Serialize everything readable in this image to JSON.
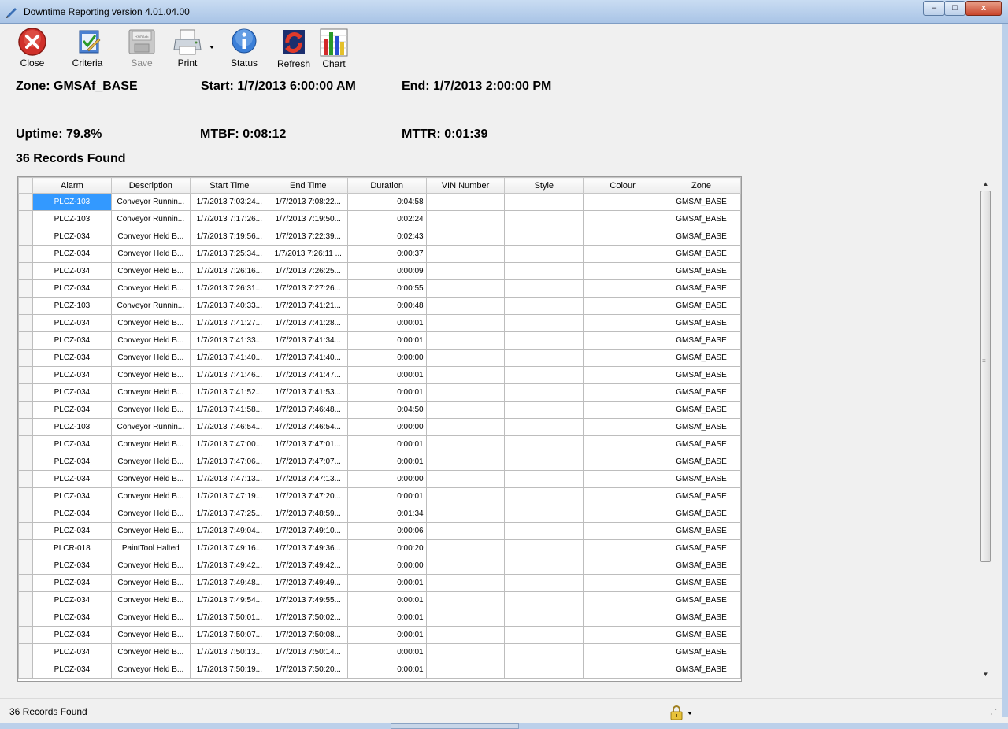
{
  "window": {
    "title": "Downtime Reporting  version  4.01.04.00",
    "min_glyph": "‒",
    "max_glyph": "□",
    "close_glyph": "x"
  },
  "toolbar": {
    "close_label": "Close",
    "criteria_label": "Criteria",
    "save_label": "Save",
    "save_icon_text": "RANGE",
    "print_label": "Print",
    "status_label": "Status",
    "refresh_label": "Refresh",
    "chart_label": "Chart"
  },
  "summary": {
    "zone": "Zone: GMSAf_BASE",
    "start": "Start: 1/7/2013 6:00:00 AM",
    "end": "End: 1/7/2013 2:00:00 PM",
    "uptime": "Uptime: 79.8%",
    "mtbf": "MTBF: 0:08:12",
    "mttr": "MTTR: 0:01:39",
    "records": "36 Records Found"
  },
  "grid": {
    "columns": [
      "Alarm",
      "Description",
      "Start Time",
      "End Time",
      "Duration",
      "VIN Number",
      "Style",
      "Colour",
      "Zone"
    ],
    "selected_row": 0,
    "rows": [
      [
        "PLCZ-103",
        "Conveyor Runnin...",
        "1/7/2013 7:03:24...",
        "1/7/2013 7:08:22...",
        "0:04:58",
        "",
        "",
        "",
        "GMSAf_BASE"
      ],
      [
        "PLCZ-103",
        "Conveyor Runnin...",
        "1/7/2013 7:17:26...",
        "1/7/2013 7:19:50...",
        "0:02:24",
        "",
        "",
        "",
        "GMSAf_BASE"
      ],
      [
        "PLCZ-034",
        "Conveyor Held B...",
        "1/7/2013 7:19:56...",
        "1/7/2013 7:22:39...",
        "0:02:43",
        "",
        "",
        "",
        "GMSAf_BASE"
      ],
      [
        "PLCZ-034",
        "Conveyor Held B...",
        "1/7/2013 7:25:34...",
        "1/7/2013 7:26:11 ...",
        "0:00:37",
        "",
        "",
        "",
        "GMSAf_BASE"
      ],
      [
        "PLCZ-034",
        "Conveyor Held B...",
        "1/7/2013 7:26:16...",
        "1/7/2013 7:26:25...",
        "0:00:09",
        "",
        "",
        "",
        "GMSAf_BASE"
      ],
      [
        "PLCZ-034",
        "Conveyor Held B...",
        "1/7/2013 7:26:31...",
        "1/7/2013 7:27:26...",
        "0:00:55",
        "",
        "",
        "",
        "GMSAf_BASE"
      ],
      [
        "PLCZ-103",
        "Conveyor Runnin...",
        "1/7/2013 7:40:33...",
        "1/7/2013 7:41:21...",
        "0:00:48",
        "",
        "",
        "",
        "GMSAf_BASE"
      ],
      [
        "PLCZ-034",
        "Conveyor Held B...",
        "1/7/2013 7:41:27...",
        "1/7/2013 7:41:28...",
        "0:00:01",
        "",
        "",
        "",
        "GMSAf_BASE"
      ],
      [
        "PLCZ-034",
        "Conveyor Held B...",
        "1/7/2013 7:41:33...",
        "1/7/2013 7:41:34...",
        "0:00:01",
        "",
        "",
        "",
        "GMSAf_BASE"
      ],
      [
        "PLCZ-034",
        "Conveyor Held B...",
        "1/7/2013 7:41:40...",
        "1/7/2013 7:41:40...",
        "0:00:00",
        "",
        "",
        "",
        "GMSAf_BASE"
      ],
      [
        "PLCZ-034",
        "Conveyor Held B...",
        "1/7/2013 7:41:46...",
        "1/7/2013 7:41:47...",
        "0:00:01",
        "",
        "",
        "",
        "GMSAf_BASE"
      ],
      [
        "PLCZ-034",
        "Conveyor Held B...",
        "1/7/2013 7:41:52...",
        "1/7/2013 7:41:53...",
        "0:00:01",
        "",
        "",
        "",
        "GMSAf_BASE"
      ],
      [
        "PLCZ-034",
        "Conveyor Held B...",
        "1/7/2013 7:41:58...",
        "1/7/2013 7:46:48...",
        "0:04:50",
        "",
        "",
        "",
        "GMSAf_BASE"
      ],
      [
        "PLCZ-103",
        "Conveyor Runnin...",
        "1/7/2013 7:46:54...",
        "1/7/2013 7:46:54...",
        "0:00:00",
        "",
        "",
        "",
        "GMSAf_BASE"
      ],
      [
        "PLCZ-034",
        "Conveyor Held B...",
        "1/7/2013 7:47:00...",
        "1/7/2013 7:47:01...",
        "0:00:01",
        "",
        "",
        "",
        "GMSAf_BASE"
      ],
      [
        "PLCZ-034",
        "Conveyor Held B...",
        "1/7/2013 7:47:06...",
        "1/7/2013 7:47:07...",
        "0:00:01",
        "",
        "",
        "",
        "GMSAf_BASE"
      ],
      [
        "PLCZ-034",
        "Conveyor Held B...",
        "1/7/2013 7:47:13...",
        "1/7/2013 7:47:13...",
        "0:00:00",
        "",
        "",
        "",
        "GMSAf_BASE"
      ],
      [
        "PLCZ-034",
        "Conveyor Held B...",
        "1/7/2013 7:47:19...",
        "1/7/2013 7:47:20...",
        "0:00:01",
        "",
        "",
        "",
        "GMSAf_BASE"
      ],
      [
        "PLCZ-034",
        "Conveyor Held B...",
        "1/7/2013 7:47:25...",
        "1/7/2013 7:48:59...",
        "0:01:34",
        "",
        "",
        "",
        "GMSAf_BASE"
      ],
      [
        "PLCZ-034",
        "Conveyor Held B...",
        "1/7/2013 7:49:04...",
        "1/7/2013 7:49:10...",
        "0:00:06",
        "",
        "",
        "",
        "GMSAf_BASE"
      ],
      [
        "PLCR-018",
        "PaintTool Halted",
        "1/7/2013 7:49:16...",
        "1/7/2013 7:49:36...",
        "0:00:20",
        "",
        "",
        "",
        "GMSAf_BASE"
      ],
      [
        "PLCZ-034",
        "Conveyor Held B...",
        "1/7/2013 7:49:42...",
        "1/7/2013 7:49:42...",
        "0:00:00",
        "",
        "",
        "",
        "GMSAf_BASE"
      ],
      [
        "PLCZ-034",
        "Conveyor Held B...",
        "1/7/2013 7:49:48...",
        "1/7/2013 7:49:49...",
        "0:00:01",
        "",
        "",
        "",
        "GMSAf_BASE"
      ],
      [
        "PLCZ-034",
        "Conveyor Held B...",
        "1/7/2013 7:49:54...",
        "1/7/2013 7:49:55...",
        "0:00:01",
        "",
        "",
        "",
        "GMSAf_BASE"
      ],
      [
        "PLCZ-034",
        "Conveyor Held B...",
        "1/7/2013 7:50:01...",
        "1/7/2013 7:50:02...",
        "0:00:01",
        "",
        "",
        "",
        "GMSAf_BASE"
      ],
      [
        "PLCZ-034",
        "Conveyor Held B...",
        "1/7/2013 7:50:07...",
        "1/7/2013 7:50:08...",
        "0:00:01",
        "",
        "",
        "",
        "GMSAf_BASE"
      ],
      [
        "PLCZ-034",
        "Conveyor Held B...",
        "1/7/2013 7:50:13...",
        "1/7/2013 7:50:14...",
        "0:00:01",
        "",
        "",
        "",
        "GMSAf_BASE"
      ],
      [
        "PLCZ-034",
        "Conveyor Held B...",
        "1/7/2013 7:50:19...",
        "1/7/2013 7:50:20...",
        "0:00:01",
        "",
        "",
        "",
        "GMSAf_BASE"
      ]
    ]
  },
  "statusbar": {
    "text": "36 Records Found"
  },
  "icons": {
    "close": "close-icon",
    "criteria": "criteria-icon",
    "save": "floppy-disk-icon",
    "print": "printer-icon",
    "status": "info-icon",
    "refresh": "refresh-icon",
    "chart": "bar-chart-icon",
    "lock": "padlock-icon"
  },
  "colors": {
    "selection": "#3399ff",
    "titlebar": "#b9cfea",
    "close_red": "#d0302a"
  }
}
